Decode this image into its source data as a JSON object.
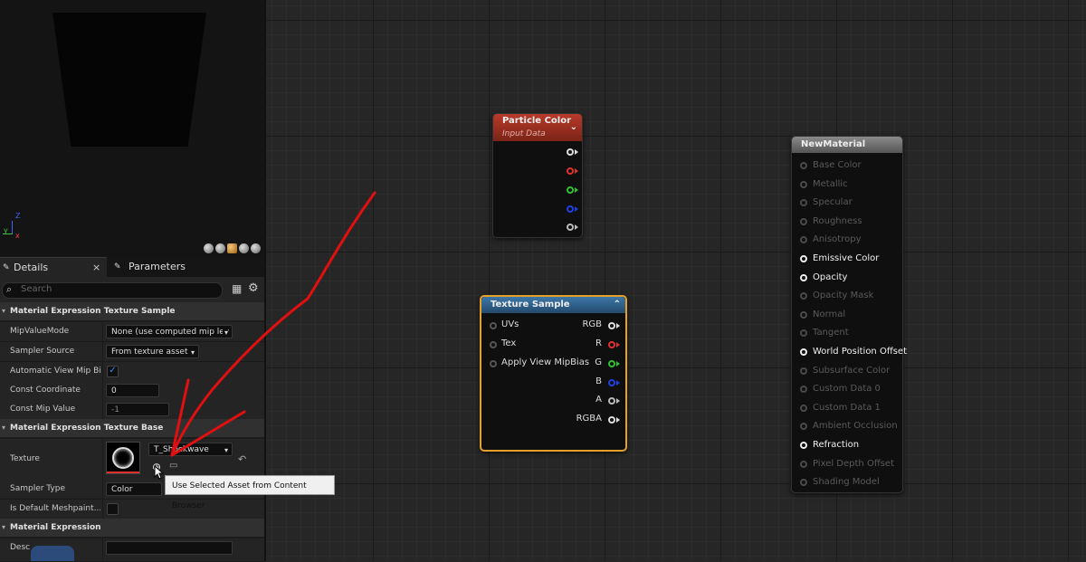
{
  "viewport": {
    "axis_z": "Z",
    "axis_y": "y",
    "axis_x": "x"
  },
  "tabs": {
    "details": "Details",
    "details_close": "×",
    "parameters": "Parameters"
  },
  "search": {
    "placeholder": "Search"
  },
  "sections": {
    "texture_sample": "Material Expression Texture Sample",
    "texture_base": "Material Expression Texture Base",
    "expression": "Material Expression"
  },
  "properties": {
    "mip_value_mode": {
      "label": "MipValueMode",
      "value": "None (use computed mip lev"
    },
    "sampler_source": {
      "label": "Sampler Source",
      "value": "From texture asset"
    },
    "auto_view_mip": {
      "label": "Automatic View Mip Bi...",
      "checked": true
    },
    "const_coordinate": {
      "label": "Const Coordinate",
      "value": "0"
    },
    "const_mip_value": {
      "label": "Const Mip Value",
      "value": "-1"
    },
    "texture": {
      "label": "Texture",
      "value": "T_Shockwave"
    },
    "sampler_type": {
      "label": "Sampler Type",
      "value": "Color"
    },
    "is_default_meshpaint": {
      "label": "Is Default Meshpaint...",
      "checked": false
    },
    "desc": {
      "label": "Desc",
      "value": ""
    }
  },
  "tooltip": "Use Selected Asset from Content Browser",
  "nodes": {
    "particle_color": {
      "title": "Particle Color",
      "subtitle": "Input Data",
      "header_color": "#9a2a1c"
    },
    "texture_sample": {
      "title": "Texture Sample",
      "header_color": "#2d5b86",
      "border_color": "#e3a02a",
      "inputs": [
        "UVs",
        "Tex",
        "Apply View MipBias"
      ],
      "outputs": [
        "RGB",
        "R",
        "G",
        "B",
        "A",
        "RGBA"
      ]
    },
    "new_material": {
      "title": "NewMaterial",
      "inputs": [
        {
          "label": "Base Color",
          "active": false
        },
        {
          "label": "Metallic",
          "active": false
        },
        {
          "label": "Specular",
          "active": false
        },
        {
          "label": "Roughness",
          "active": false
        },
        {
          "label": "Anisotropy",
          "active": false
        },
        {
          "label": "Emissive Color",
          "active": true
        },
        {
          "label": "Opacity",
          "active": true
        },
        {
          "label": "Opacity Mask",
          "active": false
        },
        {
          "label": "Normal",
          "active": false
        },
        {
          "label": "Tangent",
          "active": false
        },
        {
          "label": "World Position Offset",
          "active": true
        },
        {
          "label": "Subsurface Color",
          "active": false
        },
        {
          "label": "Custom Data 0",
          "active": false
        },
        {
          "label": "Custom Data 1",
          "active": false
        },
        {
          "label": "Ambient Occlusion",
          "active": false
        },
        {
          "label": "Refraction",
          "active": true
        },
        {
          "label": "Pixel Depth Offset",
          "active": false
        },
        {
          "label": "Shading Model",
          "active": false
        }
      ]
    }
  },
  "colors": {
    "red": "#e03030",
    "green": "#30c030",
    "blue": "#2040e0",
    "annotation": "#e01010"
  }
}
